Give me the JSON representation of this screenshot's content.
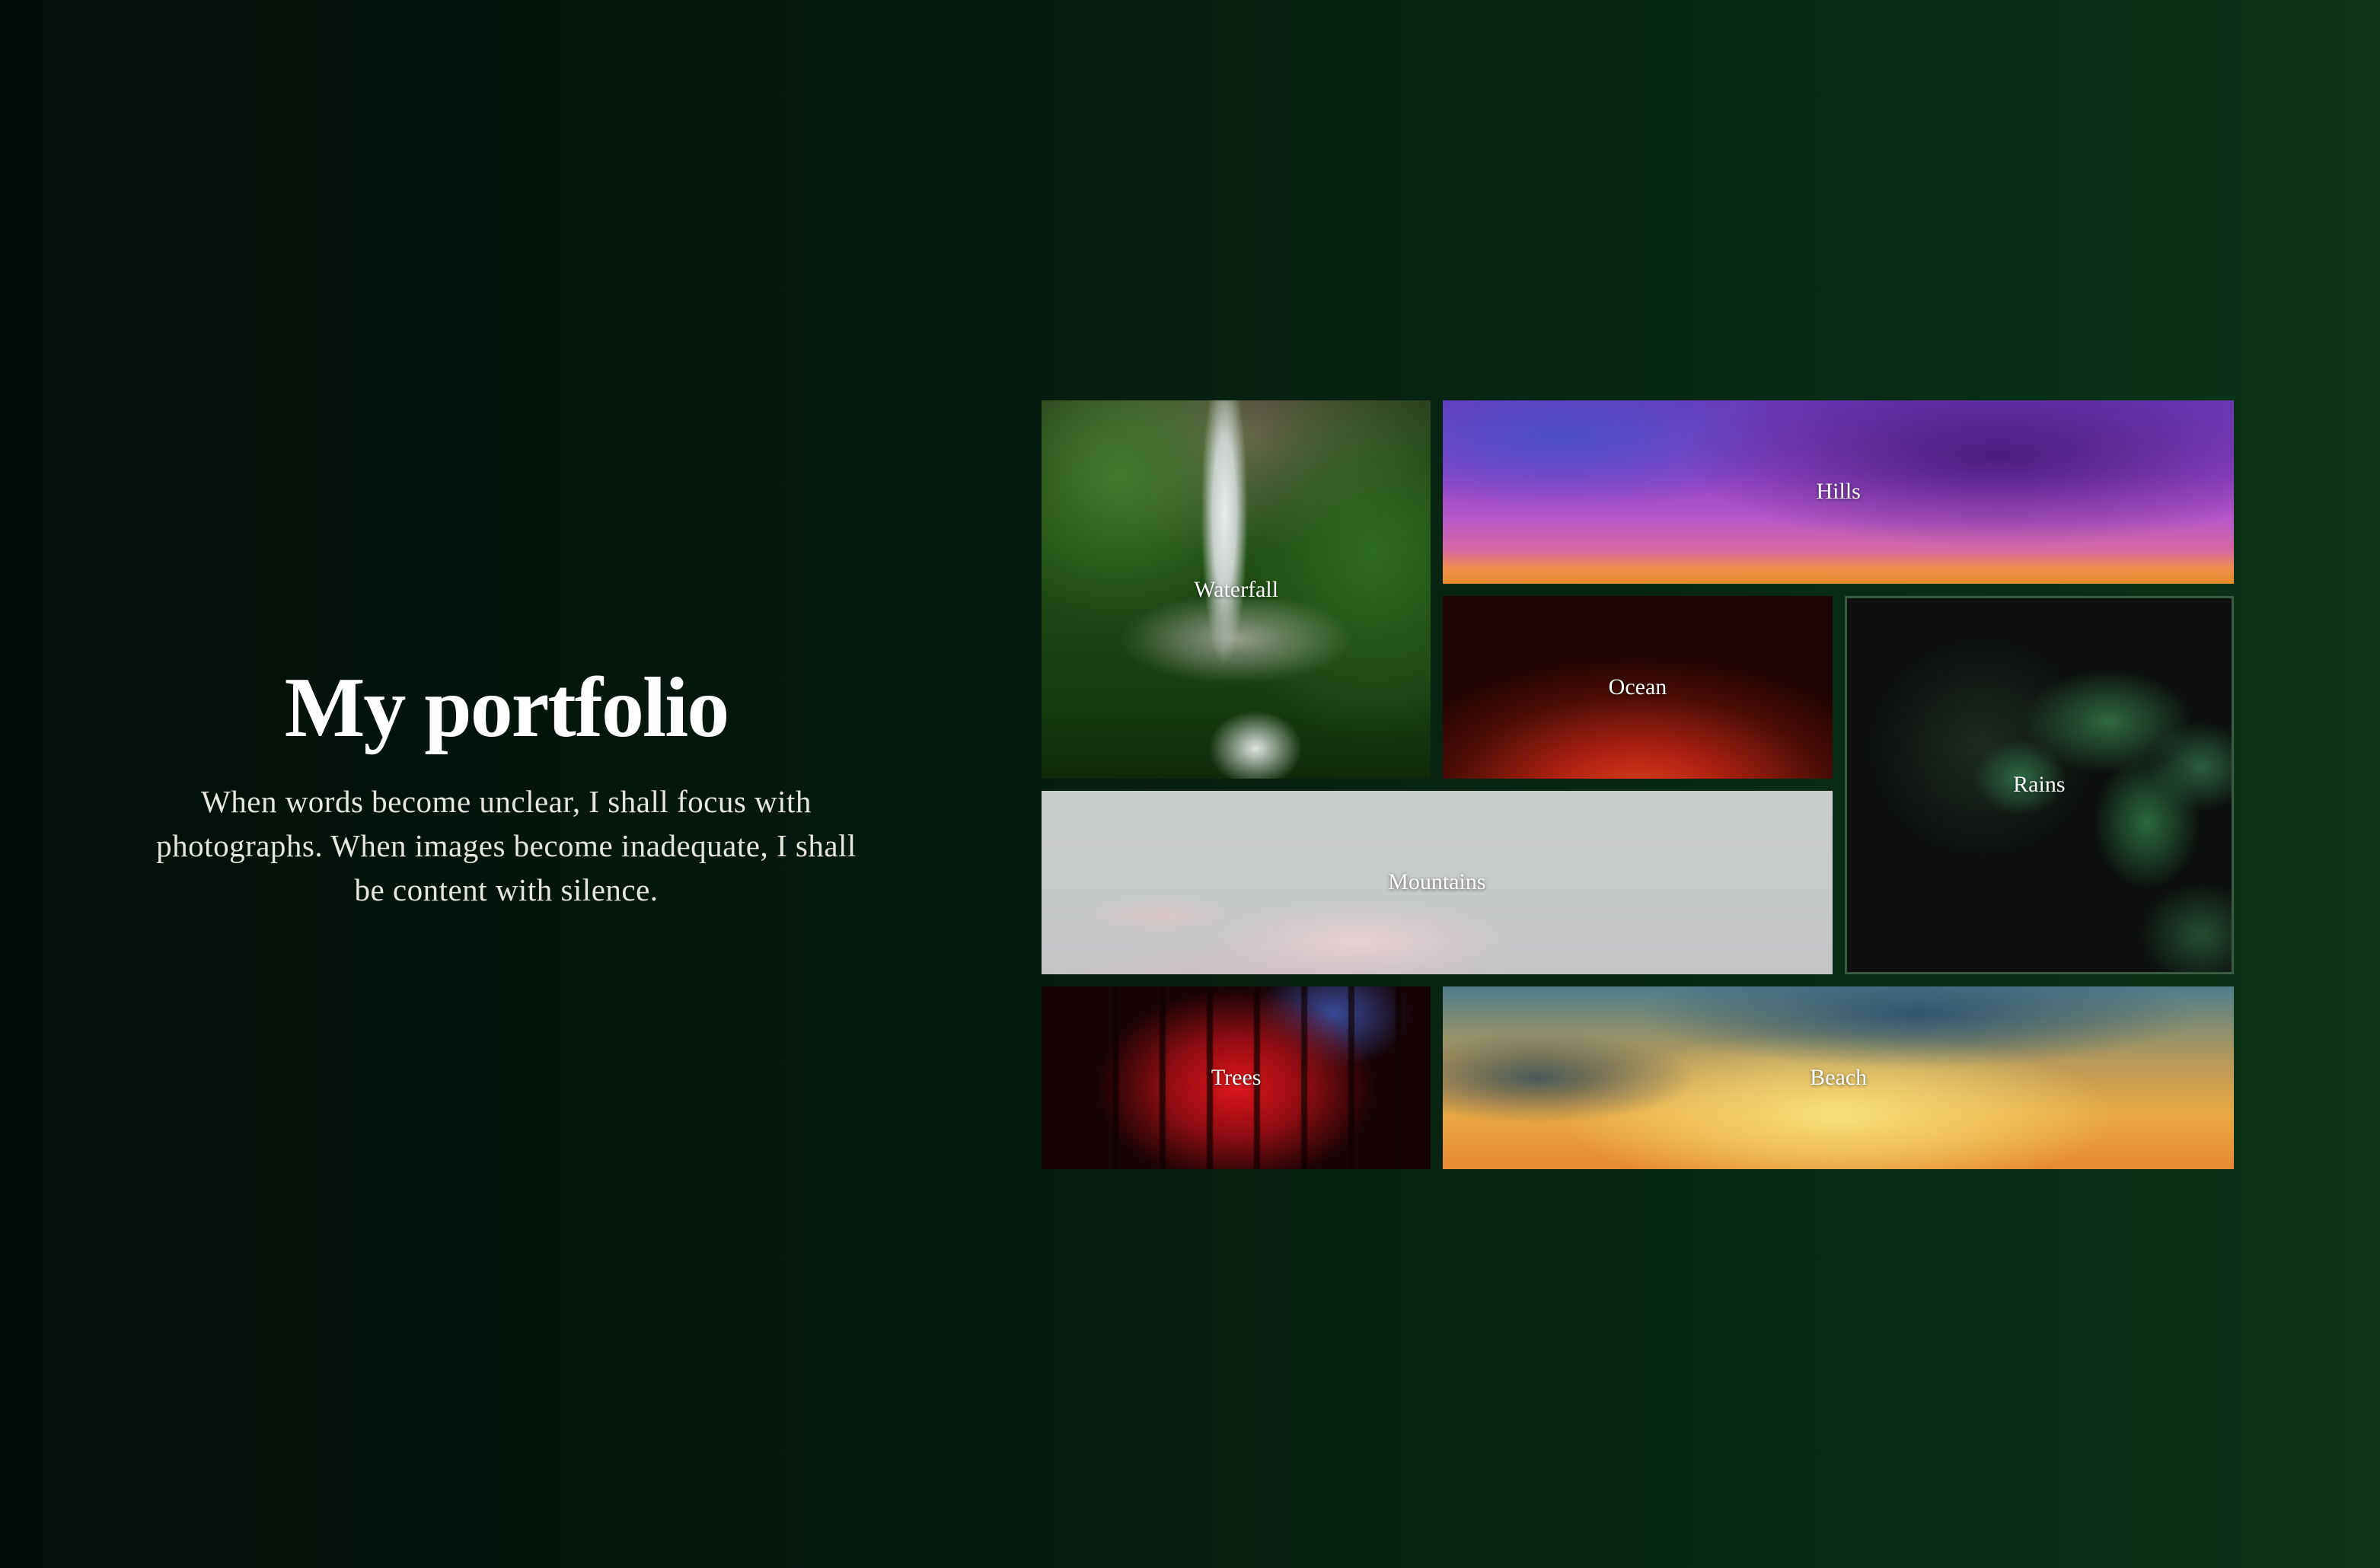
{
  "intro": {
    "title": "My portfolio",
    "description": "When words become unclear, I shall focus with photographs. When images become inadequate, I shall be content with silence."
  },
  "gallery": {
    "items": [
      {
        "label": "Waterfall"
      },
      {
        "label": "Hills"
      },
      {
        "label": "Ocean"
      },
      {
        "label": "Rains"
      },
      {
        "label": "Mountains"
      },
      {
        "label": "Trees"
      },
      {
        "label": "Beach"
      }
    ]
  },
  "colors": {
    "background_start": "#030e08",
    "background_end": "#0b3418",
    "text": "#ffffff"
  }
}
